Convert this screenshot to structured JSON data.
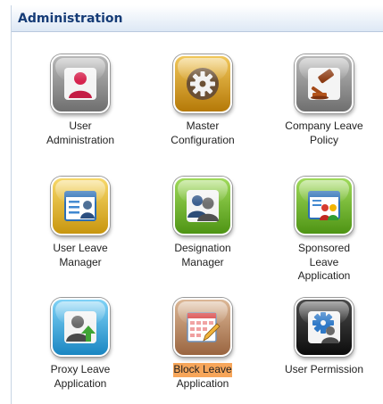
{
  "panel": {
    "title": "Administration"
  },
  "tiles": [
    {
      "line1": "User",
      "line2": "Administration",
      "line3": "",
      "icon": "user-admin-icon",
      "color": "#8c8c8c"
    },
    {
      "line1": "Master",
      "line2": "Configuration",
      "line3": "",
      "icon": "gear-icon",
      "color": "#d39a16"
    },
    {
      "line1": "Company Leave",
      "line2": "Policy",
      "line3": "",
      "icon": "gavel-icon",
      "color": "#8c8c8c"
    },
    {
      "line1": "User Leave",
      "line2": "Manager",
      "line3": "",
      "icon": "user-list-icon",
      "color": "#e6b928"
    },
    {
      "line1": "Designation",
      "line2": "Manager",
      "line3": "",
      "icon": "users-group-icon",
      "color": "#6ab528"
    },
    {
      "line1": "Sponsored",
      "line2": "Leave",
      "line3": "Application",
      "icon": "sponsored-leave-icon",
      "color": "#6ab528"
    },
    {
      "line1": "Proxy Leave",
      "line2": "Application",
      "line3": "",
      "icon": "proxy-user-icon",
      "color": "#2fa7de"
    },
    {
      "line1": "Block Leave",
      "line2": "Application",
      "line3": "",
      "icon": "calendar-edit-icon",
      "color": "#b07850",
      "highlighted": true
    },
    {
      "line1": "User Permission",
      "line2": "",
      "line3": "",
      "icon": "user-permission-icon",
      "color": "#1d1d1d"
    }
  ]
}
